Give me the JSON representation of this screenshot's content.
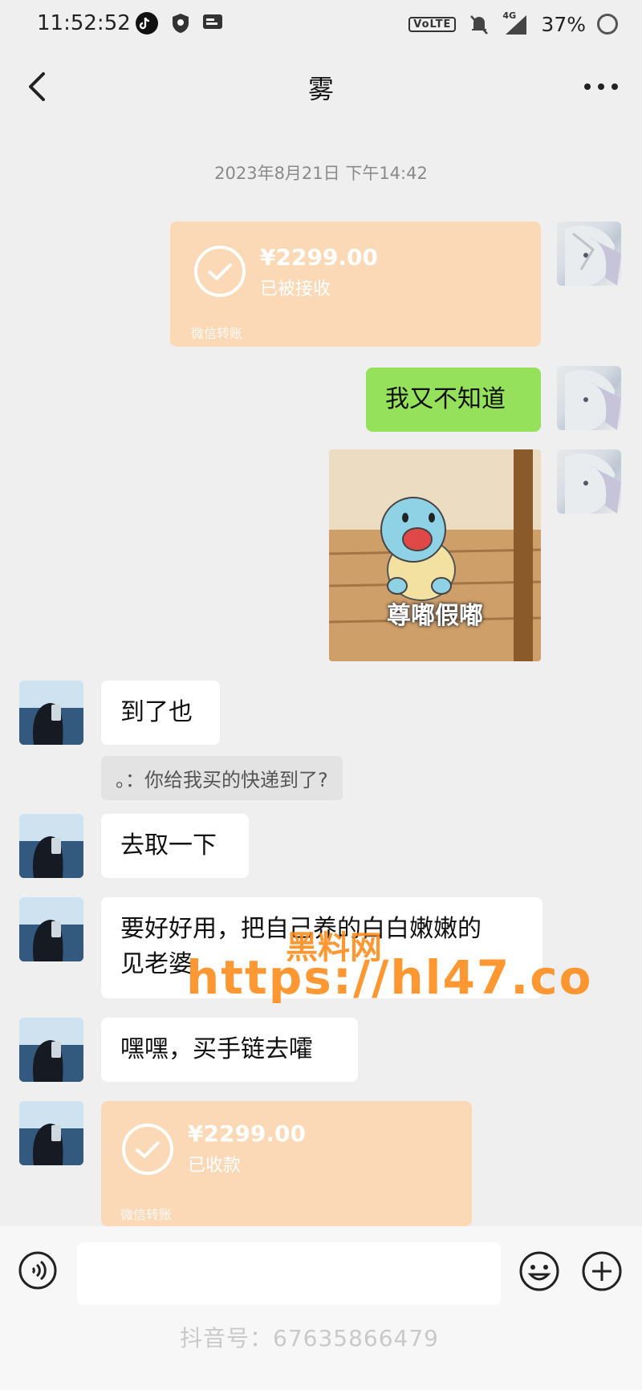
{
  "status_bar": {
    "time": "11:52:52",
    "network_badge": "VoLTE",
    "signal_label": "4G",
    "battery": "37%"
  },
  "header": {
    "title": "雾"
  },
  "timestamp": "2023年8月21日 下午14:42",
  "messages": {
    "transfer_sent": {
      "amount": "¥2299.00",
      "status": "已被接收",
      "footer": "微信转账"
    },
    "self_text": "我又不知道",
    "sticker_caption": "尊嘟假嘟",
    "other_1": "到了也",
    "quote": "。：你给我买的快递到了?",
    "other_2": "去取一下",
    "other_3_line1": "要好好用，把自己养的白白嫩嫩的",
    "other_3_line2": "见老婆",
    "other_4": "嘿嘿，买手链去嚯",
    "transfer_received": {
      "amount": "¥2299.00",
      "status": "已收款",
      "footer": "微信转账"
    }
  },
  "watermark": {
    "line1": "黑料网",
    "line2": "https://hl47.co",
    "footer": "抖音号：67635866479"
  },
  "input": {
    "placeholder": ""
  },
  "colors": {
    "self_bubble": "#95e15b",
    "transfer": "#fbd9b6",
    "background": "#efefef",
    "watermark": "#ff8a17"
  },
  "icons": {
    "back": "chevron-left-icon",
    "more": "more-dots-icon",
    "voice": "voice-icon",
    "emoji": "emoji-icon",
    "plus": "plus-icon"
  }
}
